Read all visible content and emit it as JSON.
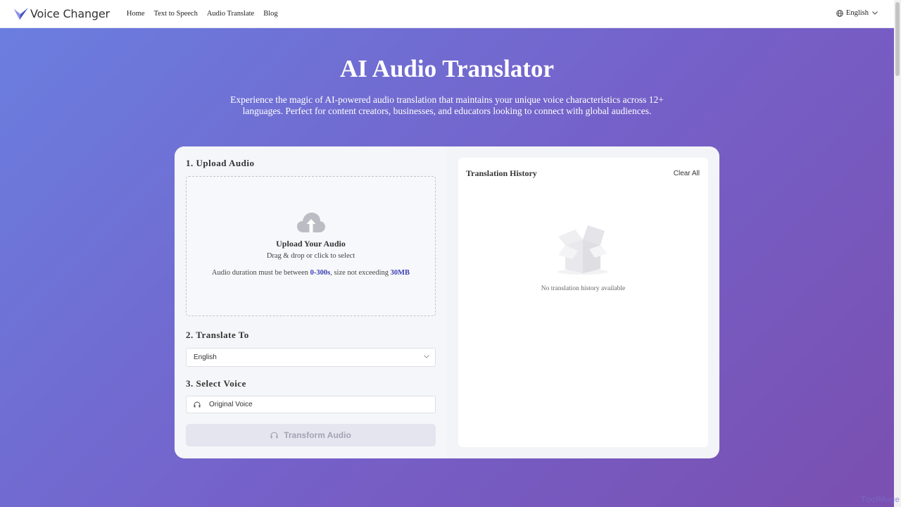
{
  "header": {
    "app_name": "Voice Changer",
    "nav": [
      "Home",
      "Text to Speech",
      "Audio Translate",
      "Blog"
    ],
    "language": "English"
  },
  "hero": {
    "title": "AI Audio Translator",
    "subtitle": "Experience the magic of AI-powered audio translation that maintains your unique voice characteristics across 12+ languages. Perfect for content creators, businesses, and educators looking to connect with global audiences."
  },
  "upload": {
    "section_title": "1. Upload Audio",
    "title": "Upload Your Audio",
    "hint": "Drag & drop or click to select",
    "limit_prefix": "Audio duration must be between ",
    "limit_duration": "0-300s",
    "limit_middle": ", size not exceeding ",
    "limit_size": "30MB"
  },
  "translate": {
    "section_title": "2. Translate To",
    "selected": "English"
  },
  "voice": {
    "section_title": "3. Select Voice",
    "selected": "Original Voice"
  },
  "transform_button": "Transform Audio",
  "history": {
    "title": "Translation History",
    "clear_label": "Clear All",
    "empty_text": "No translation history available"
  },
  "watermark": "ToolMage",
  "colors": {
    "accent": "#3c3eb2",
    "gradient_start": "#6a7fe0",
    "gradient_end": "#7a4fb0"
  }
}
